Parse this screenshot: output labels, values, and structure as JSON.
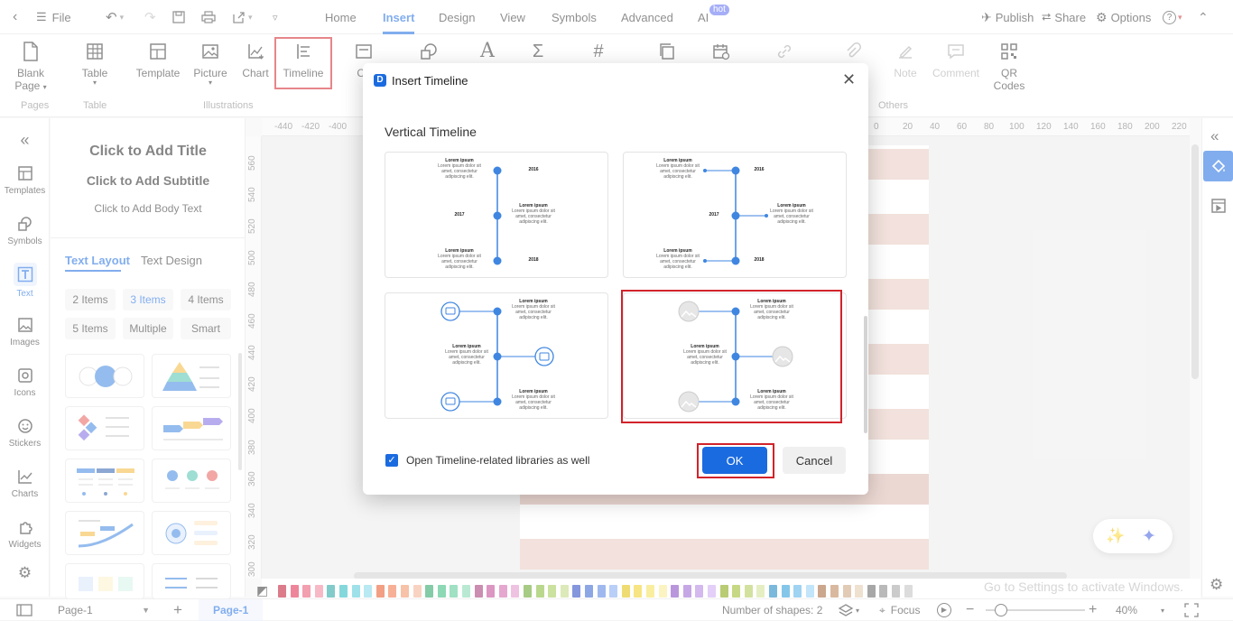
{
  "titlebar": {
    "file": "File",
    "tabs": [
      "Home",
      "Insert",
      "Design",
      "View",
      "Symbols",
      "Advanced",
      "AI"
    ],
    "active_tab": "Insert",
    "hot_badge": "hot",
    "publish": "Publish",
    "share": "Share",
    "options": "Options"
  },
  "ribbon": {
    "buttons": [
      {
        "label": "Blank\nPage",
        "icon": "page-icon"
      },
      {
        "label": "Table",
        "icon": "table-icon"
      },
      {
        "label": "Template",
        "icon": "template-icon"
      },
      {
        "label": "Picture",
        "icon": "picture-icon"
      },
      {
        "label": "Chart",
        "icon": "chart-icon"
      },
      {
        "label": "Timeline",
        "icon": "timeline-icon"
      },
      {
        "label": "Co",
        "icon": "container-icon"
      },
      {
        "label": "nt",
        "icon": "attachment-icon"
      },
      {
        "label": "Note",
        "icon": "note-icon"
      },
      {
        "label": "Comment",
        "icon": "comment-icon"
      },
      {
        "label": "QR\nCodes",
        "icon": "qr-icon"
      }
    ],
    "groups": [
      "Pages",
      "Table",
      "Illustrations",
      "Others"
    ]
  },
  "leftnav": {
    "items": [
      "Templates",
      "Symbols",
      "Text",
      "Images",
      "Icons",
      "Stickers",
      "Charts",
      "Widgets"
    ],
    "active": "Text"
  },
  "panel": {
    "title": "Click to Add Title",
    "subtitle": "Click to Add Subtitle",
    "body": "Click to Add Body Text",
    "tab_layout": "Text Layout",
    "tab_design": "Text Design",
    "chips": [
      "2 Items",
      "3 Items",
      "4 Items",
      "5 Items",
      "Multiple",
      "Smart"
    ],
    "active_chip": "3 Items"
  },
  "ruler": {
    "h": [
      "-440",
      "-420",
      "-400",
      "0",
      "20",
      "40",
      "60",
      "80",
      "100",
      "120",
      "140",
      "160",
      "180",
      "200",
      "220"
    ],
    "v": [
      "560",
      "540",
      "520",
      "500",
      "480",
      "460",
      "440",
      "420",
      "400",
      "380",
      "360",
      "340",
      "320",
      "300"
    ]
  },
  "dialog": {
    "title": "Insert Timeline",
    "section": "Vertical Timeline",
    "lorem": "Lorem ipsum",
    "lorem_body": "Lorem ipsum dolor sit amet, consectetur adipiscing elit.",
    "years": [
      "2016",
      "2017",
      "2018"
    ],
    "checkbox_label": "Open Timeline-related libraries as well",
    "checkbox_checked": true,
    "ok": "OK",
    "cancel": "Cancel"
  },
  "status": {
    "page_select": "Page-1",
    "page_tab": "Page-1",
    "shapes": "Number of shapes: 2",
    "focus": "Focus",
    "zoom": "40%",
    "watermark": "Go to Settings to activate Windows."
  },
  "colors": {
    "accent": "#1b6be0",
    "highlight": "#d2232a",
    "timeline": "#3f86e0"
  }
}
